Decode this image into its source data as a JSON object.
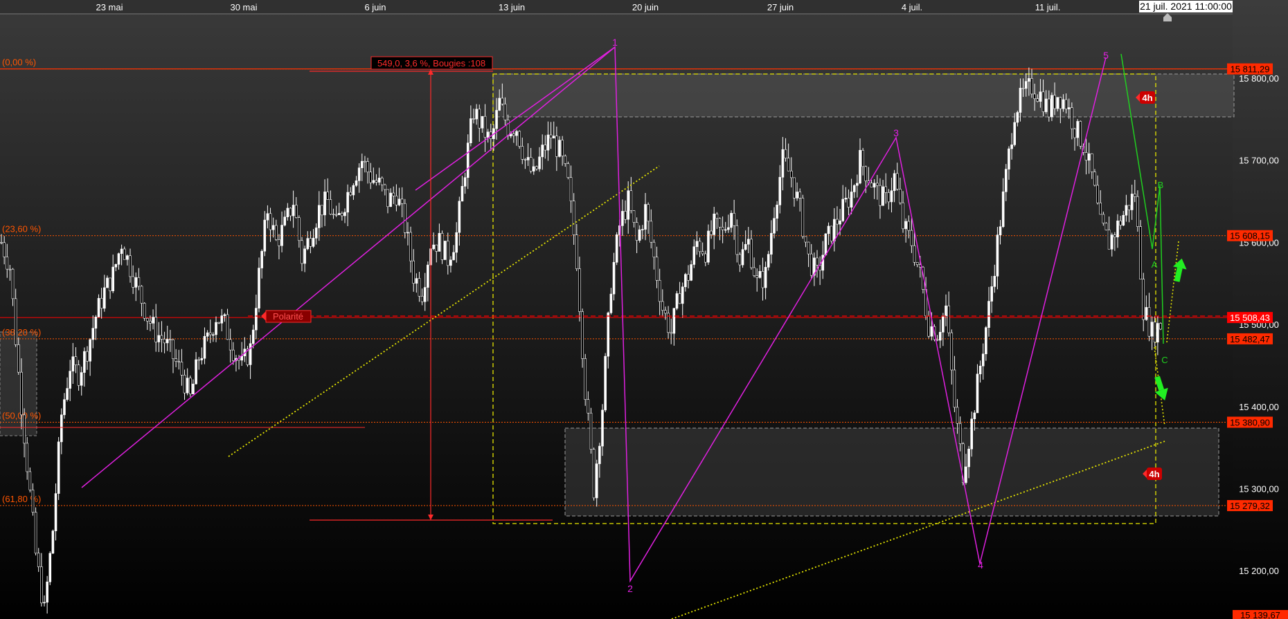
{
  "chart_data": {
    "type": "candlestick",
    "x_tick_labels": [
      "23 mai",
      "30 mai",
      "6 juin",
      "13 juin",
      "20 juin",
      "27 juin",
      "4 juil.",
      "11 juil."
    ],
    "cursor_date_label": "21 juil. 2021 11:00:00",
    "y_range": [
      15139.67,
      15870
    ],
    "y_tick_values": [
      15200,
      15300,
      15400,
      15500,
      15600,
      15700,
      15800
    ],
    "y_tick_labels": [
      "15 200,00",
      "15 300,00",
      "15 400,00",
      "15 500,00",
      "15 600,00",
      "15 700,00",
      "15 800,00"
    ],
    "fibonacci_levels": [
      {
        "label": "(0,00 %)",
        "value": 15811.29,
        "price_label": "15 811,29"
      },
      {
        "label": "(23,60 %)",
        "value": 15608.15,
        "price_label": "15 608,15"
      },
      {
        "label": "(38,20 %)",
        "value": 15482.47,
        "price_label": "15 482,47"
      },
      {
        "label": "(50,00 %)",
        "value": 15380.9,
        "price_label": "15 380,90"
      },
      {
        "label": "(61,80 %)",
        "value": 15279.32,
        "price_label": "15 279,32"
      }
    ],
    "current_price": {
      "value": 15508.43,
      "label": "15 508,43"
    },
    "bottom_price_label": "15 139,67",
    "measure_label": "549,0, 3,6 %, Bougies :108",
    "polarity_label": "Polarité",
    "timeframe_badges": [
      "4h",
      "4h"
    ],
    "elliott_wave_labels": [
      "1",
      "2",
      "3",
      "4",
      "5"
    ],
    "correction_labels": [
      "A",
      "B",
      "C"
    ],
    "price_path": [
      [
        0,
        15600
      ],
      [
        3,
        15570
      ],
      [
        6,
        15440
      ],
      [
        9,
        15330
      ],
      [
        12,
        15220
      ],
      [
        15,
        15150
      ],
      [
        18,
        15250
      ],
      [
        21,
        15390
      ],
      [
        24,
        15450
      ],
      [
        27,
        15440
      ],
      [
        30,
        15470
      ],
      [
        33,
        15510
      ],
      [
        36,
        15540
      ],
      [
        39,
        15560
      ],
      [
        42,
        15600
      ],
      [
        45,
        15570
      ],
      [
        48,
        15540
      ],
      [
        51,
        15510
      ],
      [
        54,
        15490
      ],
      [
        57,
        15480
      ],
      [
        60,
        15460
      ],
      [
        63,
        15440
      ],
      [
        66,
        15410
      ],
      [
        69,
        15460
      ],
      [
        72,
        15480
      ],
      [
        75,
        15510
      ],
      [
        78,
        15500
      ],
      [
        81,
        15470
      ],
      [
        84,
        15450
      ],
      [
        87,
        15470
      ],
      [
        90,
        15560
      ],
      [
        93,
        15640
      ],
      [
        96,
        15600
      ],
      [
        99,
        15620
      ],
      [
        102,
        15650
      ],
      [
        105,
        15580
      ],
      [
        108,
        15610
      ],
      [
        111,
        15640
      ],
      [
        114,
        15650
      ],
      [
        117,
        15620
      ],
      [
        120,
        15650
      ],
      [
        123,
        15680
      ],
      [
        126,
        15700
      ],
      [
        129,
        15680
      ],
      [
        132,
        15670
      ],
      [
        135,
        15650
      ],
      [
        138,
        15660
      ],
      [
        141,
        15620
      ],
      [
        144,
        15560
      ],
      [
        147,
        15540
      ],
      [
        150,
        15600
      ],
      [
        153,
        15600
      ],
      [
        156,
        15580
      ],
      [
        159,
        15610
      ],
      [
        162,
        15690
      ],
      [
        165,
        15760
      ],
      [
        168,
        15740
      ],
      [
        171,
        15720
      ],
      [
        174,
        15770
      ],
      [
        177,
        15740
      ],
      [
        180,
        15740
      ],
      [
        183,
        15700
      ],
      [
        186,
        15680
      ],
      [
        189,
        15710
      ],
      [
        192,
        15730
      ],
      [
        195,
        15710
      ],
      [
        198,
        15670
      ],
      [
        201,
        15580
      ],
      [
        204,
        15420
      ],
      [
        207,
        15300
      ],
      [
        210,
        15400
      ],
      [
        213,
        15550
      ],
      [
        216,
        15620
      ],
      [
        219,
        15650
      ],
      [
        222,
        15600
      ],
      [
        225,
        15640
      ],
      [
        228,
        15580
      ],
      [
        231,
        15520
      ],
      [
        234,
        15490
      ],
      [
        237,
        15540
      ],
      [
        240,
        15560
      ],
      [
        243,
        15600
      ],
      [
        246,
        15590
      ],
      [
        249,
        15620
      ],
      [
        252,
        15610
      ],
      [
        255,
        15640
      ],
      [
        258,
        15580
      ],
      [
        261,
        15600
      ],
      [
        264,
        15550
      ],
      [
        267,
        15560
      ],
      [
        270,
        15640
      ],
      [
        273,
        15700
      ],
      [
        276,
        15680
      ],
      [
        279,
        15640
      ],
      [
        282,
        15580
      ],
      [
        285,
        15560
      ],
      [
        288,
        15600
      ],
      [
        291,
        15620
      ],
      [
        294,
        15640
      ],
      [
        297,
        15660
      ],
      [
        300,
        15700
      ],
      [
        303,
        15680
      ],
      [
        306,
        15660
      ],
      [
        309,
        15650
      ],
      [
        312,
        15680
      ],
      [
        315,
        15620
      ],
      [
        318,
        15600
      ],
      [
        321,
        15560
      ],
      [
        324,
        15500
      ],
      [
        327,
        15490
      ],
      [
        330,
        15520
      ],
      [
        333,
        15400
      ],
      [
        336,
        15320
      ],
      [
        339,
        15380
      ],
      [
        342,
        15450
      ],
      [
        345,
        15520
      ],
      [
        348,
        15600
      ],
      [
        351,
        15680
      ],
      [
        354,
        15760
      ],
      [
        357,
        15780
      ],
      [
        360,
        15790
      ],
      [
        363,
        15780
      ],
      [
        366,
        15760
      ],
      [
        369,
        15780
      ],
      [
        372,
        15770
      ],
      [
        375,
        15740
      ],
      [
        378,
        15720
      ],
      [
        381,
        15680
      ],
      [
        384,
        15620
      ],
      [
        387,
        15600
      ],
      [
        390,
        15620
      ],
      [
        393,
        15640
      ],
      [
        396,
        15660
      ],
      [
        399,
        15520
      ],
      [
        402,
        15490
      ],
      [
        405,
        15500
      ]
    ]
  },
  "colors": {
    "candle": "#ffffff",
    "wave": "#e020e0",
    "fib": "#ff5500",
    "fib_label_bg": "#ff2a00",
    "current_price": "#ff0000",
    "trendline": "#e8e800",
    "correction": "#20d020",
    "zone": "#505050",
    "axis_text": "#ffffff"
  }
}
